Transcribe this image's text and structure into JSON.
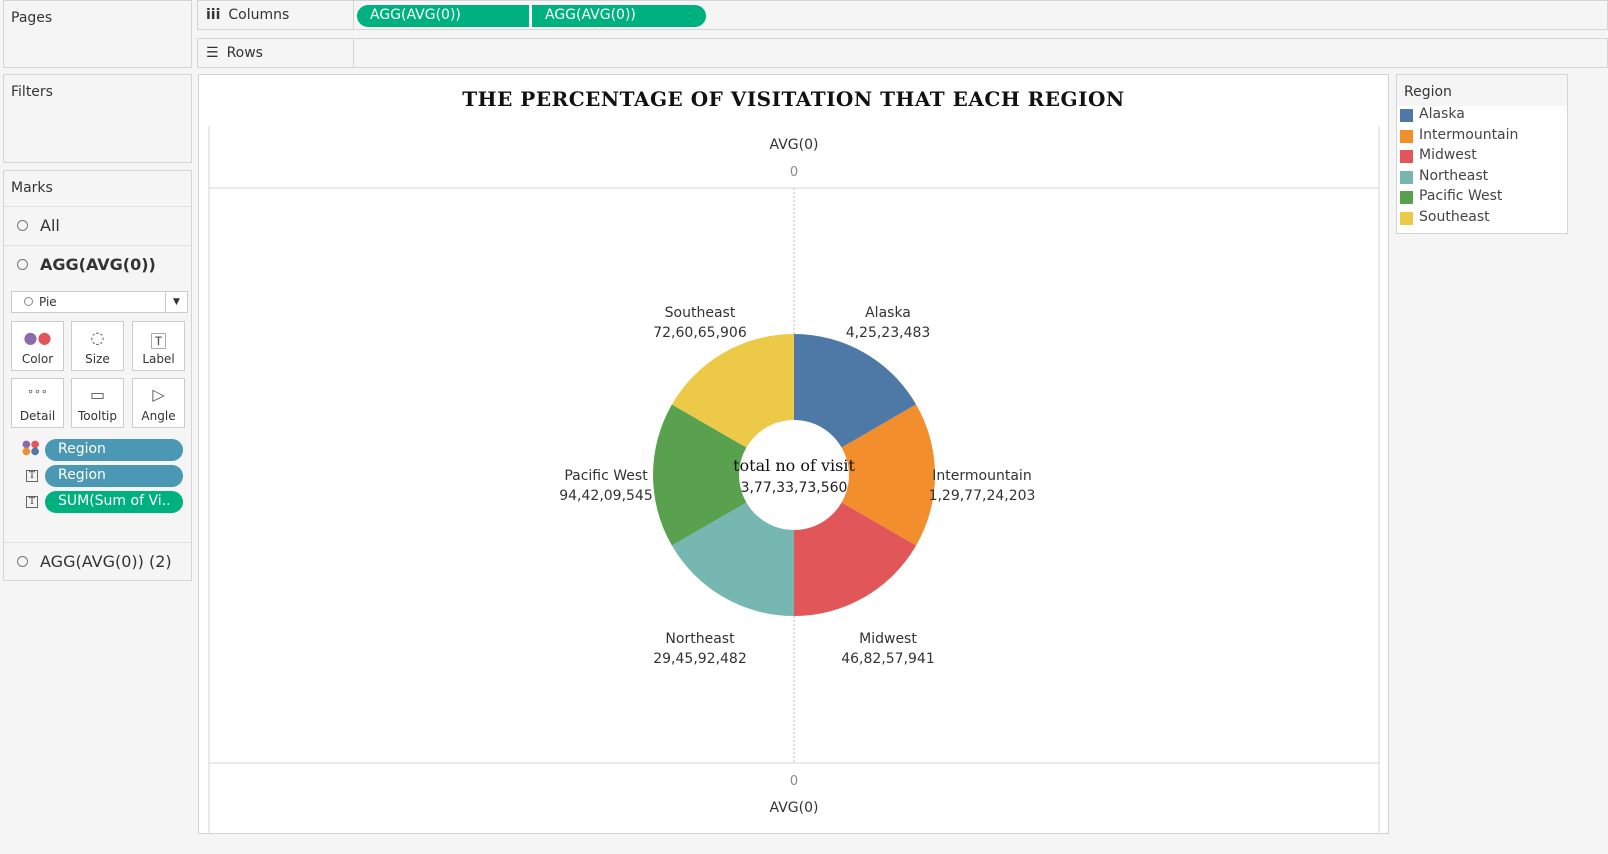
{
  "pages": {
    "title": "Pages"
  },
  "filters": {
    "title": "Filters"
  },
  "marks": {
    "title": "Marks",
    "all": "All",
    "layer1": "AGG(AVG(0))",
    "mark_type": "Pie",
    "buttons": [
      "Color",
      "Size",
      "Label",
      "Detail",
      "Tooltip",
      "Angle"
    ],
    "pills": [
      "Region",
      "Region",
      "SUM(Sum of Vi.."
    ],
    "layer2": "AGG(AVG(0)) (2)"
  },
  "shelves": {
    "columns_label": "Columns",
    "rows_label": "Rows",
    "column_pills": [
      "AGG(AVG(0))",
      "AGG(AVG(0))"
    ]
  },
  "view": {
    "title": "THE PERCENTAGE OF VISITATION THAT EACH REGION",
    "axis_top_title": "AVG(0)",
    "axis_top_tick": "0",
    "axis_bottom_tick": "0",
    "axis_bottom_title": "AVG(0)",
    "center_title": "total no of visit",
    "center_value": "3,77,33,73,560"
  },
  "legend": {
    "title": "Region",
    "items": [
      {
        "label": "Alaska",
        "color": "#4e79a7"
      },
      {
        "label": "Intermountain",
        "color": "#f28e2b"
      },
      {
        "label": "Midwest",
        "color": "#e15759"
      },
      {
        "label": "Northeast",
        "color": "#76b7b2"
      },
      {
        "label": "Pacific West",
        "color": "#59a14f"
      },
      {
        "label": "Southeast",
        "color": "#edc948"
      }
    ]
  },
  "chart_data": {
    "type": "pie",
    "title": "THE PERCENTAGE OF VISITATION THAT EACH REGION",
    "categories": [
      "Alaska",
      "Intermountain",
      "Midwest",
      "Northeast",
      "Pacific West",
      "Southeast"
    ],
    "value_labels": [
      "4,25,23,483",
      "1,29,77,24,203",
      "46,82,57,941",
      "29,45,92,482",
      "94,42,09,545",
      "72,60,65,906"
    ],
    "values": [
      42523483,
      1297724203,
      468257941,
      294592482,
      944209545,
      726065906
    ],
    "colors": [
      "#4e79a7",
      "#f28e2b",
      "#e15759",
      "#76b7b2",
      "#59a14f",
      "#edc948"
    ]
  }
}
